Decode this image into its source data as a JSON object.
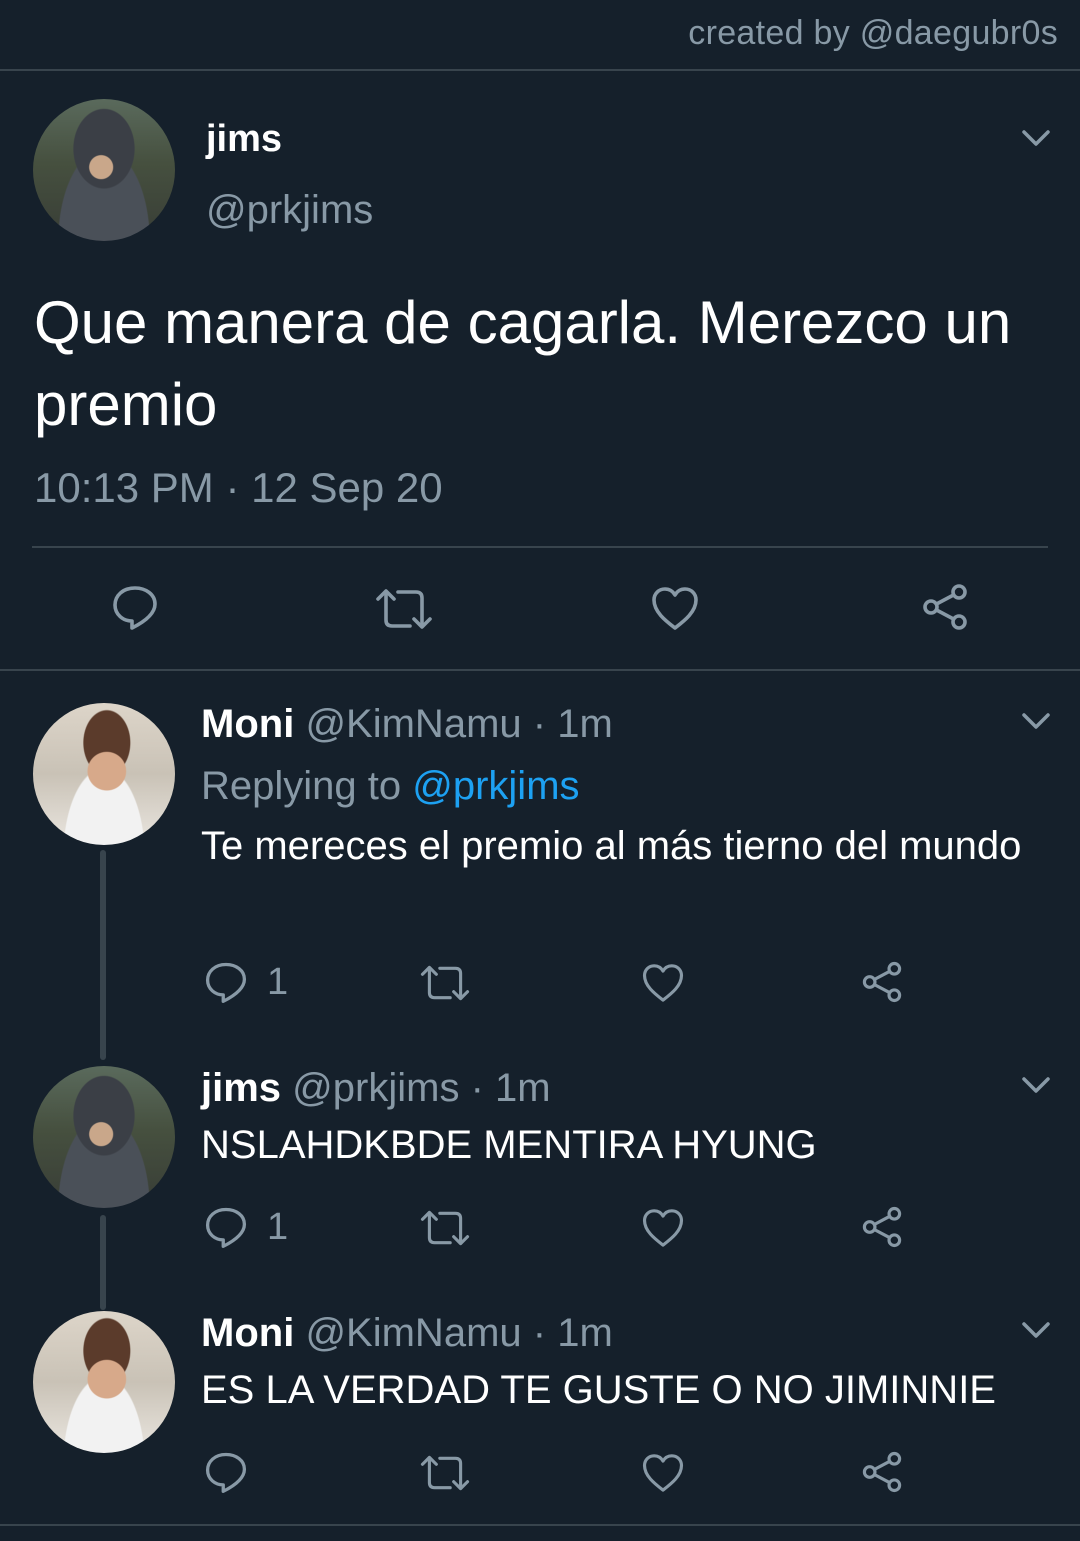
{
  "credit": "created by @daegubr0s",
  "main_tweet": {
    "name": "jims",
    "handle": "@prkjims",
    "text": "Que manera de cagarla. Merezco un premio",
    "timestamp": "10:13 PM · 12 Sep 20"
  },
  "replies": [
    {
      "name": "Moni",
      "handle": "@KimNamu",
      "time": "· 1m",
      "replying_label": "Replying to",
      "replying_to": "@prkjims",
      "text": "Te mereces el premio al más tierno del mundo",
      "reply_count": "1"
    },
    {
      "name": "jims",
      "handle": "@prkjims",
      "time": "· 1m",
      "text": "NSLAHDKBDE MENTIRA HYUNG",
      "reply_count": "1"
    },
    {
      "name": "Moni",
      "handle": "@KimNamu",
      "time": "· 1m",
      "text": "ES LA VERDAD TE GUSTE O NO JIMINNIE",
      "reply_count": ""
    }
  ],
  "colors": {
    "background": "#15202b",
    "muted": "#8899a6",
    "link": "#1da1f2",
    "divider": "#38444d"
  }
}
